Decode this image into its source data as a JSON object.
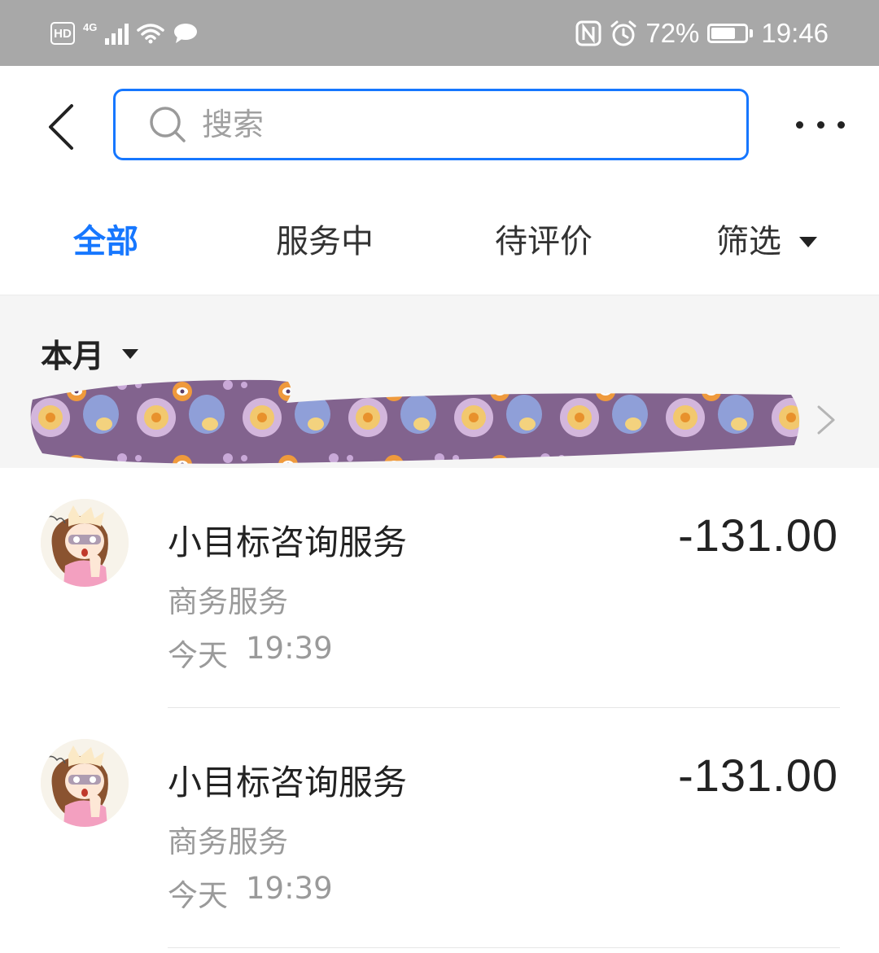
{
  "status_bar": {
    "hd": "HD",
    "network": "4G",
    "battery_percent": "72%",
    "battery_level": 0.72,
    "time": "19:46"
  },
  "top_bar": {
    "search_placeholder": "搜索"
  },
  "tabs": [
    {
      "label": "全部",
      "active": true
    },
    {
      "label": "服务中",
      "active": false
    },
    {
      "label": "待评价",
      "active": false
    },
    {
      "label": "筛选",
      "active": false
    }
  ],
  "month_section": {
    "label": "本月"
  },
  "records": [
    {
      "title": "小目标咨询服务",
      "category": "商务服务",
      "day": "今天",
      "time": "19:39",
      "amount": "-131.00"
    },
    {
      "title": "小目标咨询服务",
      "category": "商务服务",
      "day": "今天",
      "time": "19:39",
      "amount": "-131.00"
    }
  ],
  "colors": {
    "accent": "#1677ff",
    "status_bar_bg": "#a8a8a8",
    "section_bg": "#f5f5f5",
    "redaction": "#82638e"
  },
  "icons": [
    "back-arrow-icon",
    "search-icon",
    "more-icon",
    "dropdown-caret-icon",
    "chevron-right-icon",
    "nfc-icon",
    "alarm-icon",
    "wifi-icon",
    "chat-icon",
    "signal-icon",
    "battery-icon"
  ]
}
